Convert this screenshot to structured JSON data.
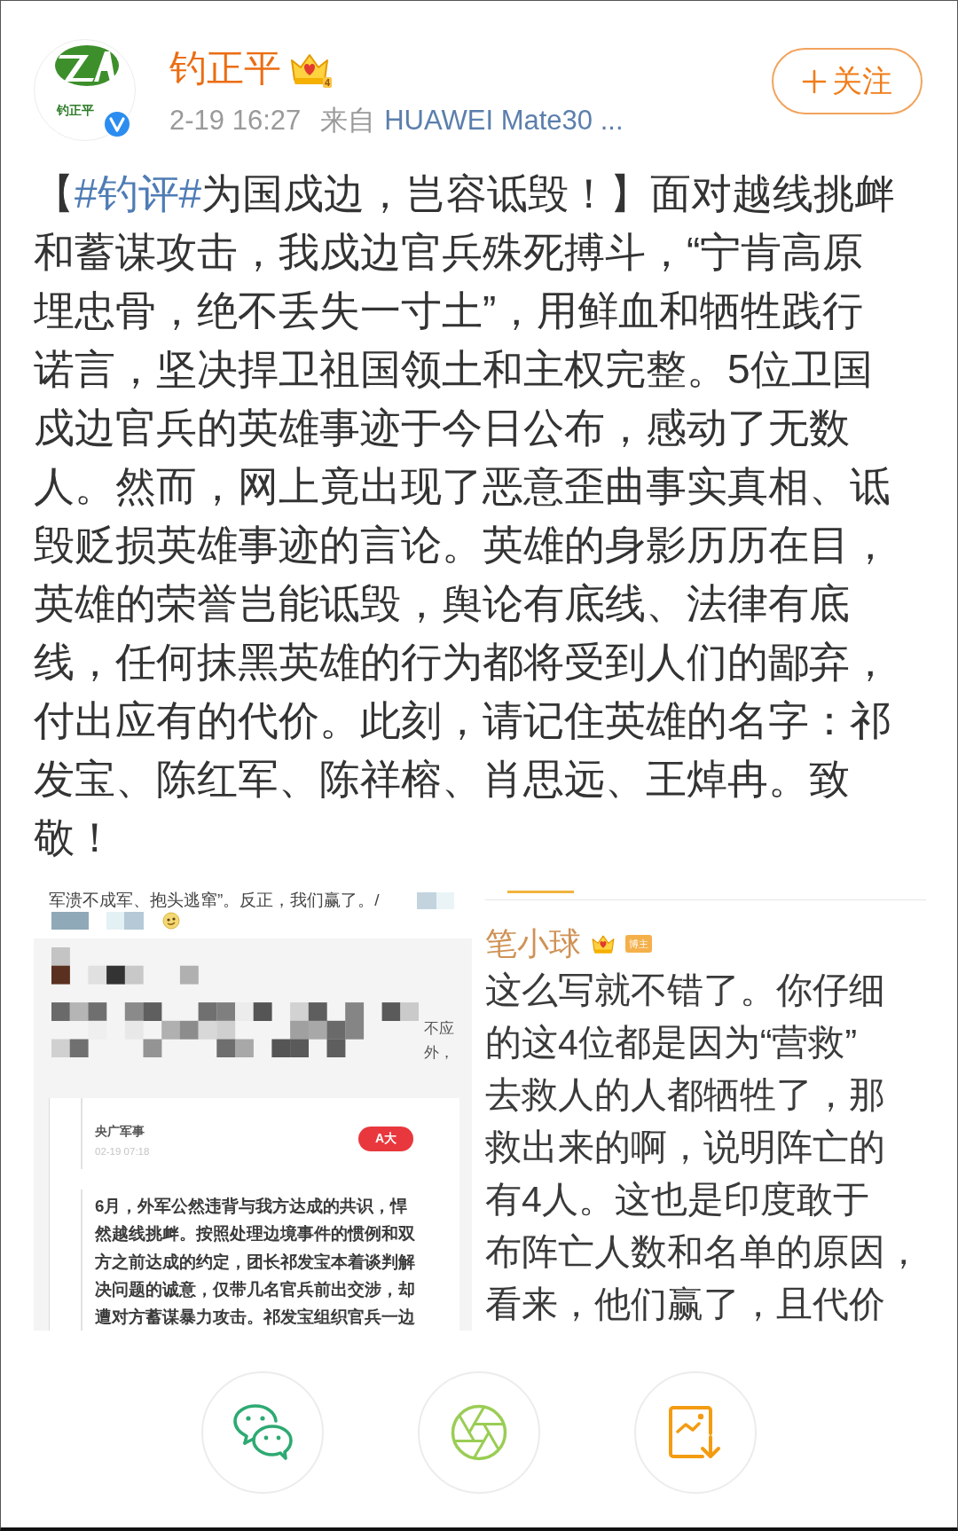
{
  "post": {
    "author": {
      "name": "钓正平",
      "logo_text": "钓正平",
      "verified": true,
      "vip_level": "4"
    },
    "time": "2-19 16:27",
    "source_label": "来自",
    "source": "HUAWEI Mate30 ...",
    "follow_button": {
      "label": "关注"
    },
    "text": {
      "prefix": "【",
      "hashtag": "#钓评#",
      "body": "为国戍边，岂容诋毁！】面对越线挑衅和蓄谋攻击，我戍边官兵殊死搏斗，“宁肯高原埋忠骨，绝不丢失一寸土”，用鲜血和牺牲践行诺言，坚决捍卫祖国领土和主权完整。5位卫国戍边官兵的英雄事迹于今日公布，感动了无数人。然而，网上竟出现了恶意歪曲事实真相、诋毁贬损英雄事迹的言论。英雄的身影历历在目，英雄的荣誉岂能诋毁，舆论有底线、法律有底线，任何抹黑英雄的行为都将受到人们的鄙弃，付出应有的代价。此刻，请记住英雄的名字：祁发宝、陈红军、陈祥榕、肖思远、王焯冉。致敬！"
    }
  },
  "images": [
    {
      "kind": "news_screenshot",
      "top_line": "军溃不成军、抱头逃窜”。反正，我们赢了。/",
      "side_lines": [
        "不应",
        "外，"
      ],
      "article": {
        "source": "央广军事",
        "time": "02-19 07:18",
        "font_button": "A大",
        "text": "6月，外军公然违背与我方达成的共识，悍然越线挑衅。按照处理边境事件的惯例和双方之前达成的约定，团长祁发宝本着谈判解决问题的诚意，仅带几名官兵前出交涉，却遭对方蓄谋暴力攻击。祁发宝组织官兵一边"
      }
    },
    {
      "kind": "comment_screenshot",
      "commenter": "笔小球",
      "tag": "博主",
      "lines": [
        "这么写就不错了。你仔细",
        "的这4位都是因为“营救”",
        "去救人的人都牺牲了，那",
        "救出来的啊，说明阵亡的",
        "有4人。这也是印度敢于",
        "布阵亡人数和名单的原因，",
        "看来，他们赢了，且代价"
      ]
    }
  ],
  "share_actions": [
    {
      "kind": "wechat"
    },
    {
      "kind": "moments"
    },
    {
      "kind": "save_image"
    }
  ]
}
